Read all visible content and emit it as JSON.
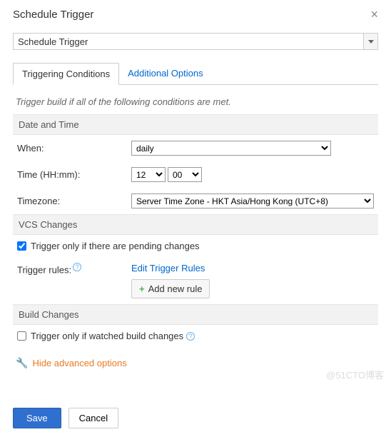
{
  "dialog": {
    "title": "Schedule Trigger"
  },
  "triggerType": {
    "selected": "Schedule Trigger"
  },
  "tabs": {
    "conditions": "Triggering Conditions",
    "additional": "Additional Options"
  },
  "intro": "Trigger build if all of the following conditions are met.",
  "sections": {
    "datetime": "Date and Time",
    "vcs": "VCS Changes",
    "build": "Build Changes"
  },
  "labels": {
    "when": "When:",
    "time": "Time (HH:mm):",
    "timezone": "Timezone:",
    "rules": "Trigger rules:"
  },
  "values": {
    "when": "daily",
    "hour": "12",
    "minute": "00",
    "timezone": "Server Time Zone - HKT Asia/Hong Kong (UTC+8)"
  },
  "vcs": {
    "pendingLabel": "Trigger only if there are pending changes",
    "editRules": "Edit Trigger Rules",
    "addRule": "Add new rule"
  },
  "build": {
    "watchedLabel": "Trigger only if watched build changes"
  },
  "advanced": "Hide advanced options",
  "buttons": {
    "save": "Save",
    "cancel": "Cancel"
  },
  "watermark": "@51CTO博客"
}
